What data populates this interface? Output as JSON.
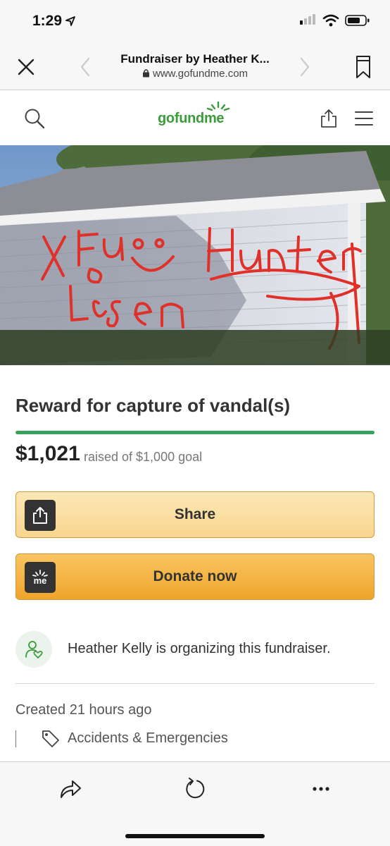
{
  "status_bar": {
    "time": "1:29",
    "icons": [
      "location-arrow-icon",
      "signal-icon",
      "wifi-icon",
      "battery-icon"
    ]
  },
  "browser": {
    "page_title": "Fundraiser by Heather K...",
    "url": "www.gofundme.com",
    "icons": [
      "close-icon",
      "back-icon",
      "forward-icon",
      "bookmarks-icon",
      "lock-icon"
    ]
  },
  "site_header": {
    "logo_text": "gofundme",
    "icons": [
      "search-icon",
      "share-icon",
      "menu-icon"
    ],
    "brand_color": "#3a9b3a"
  },
  "campaign": {
    "title": "Reward for capture of vandal(s)",
    "raised": "$1,021",
    "goal_text": "raised of $1,000 goal",
    "progress": 1.0,
    "progress_color": "#3aa35b"
  },
  "actions": {
    "share_label": "Share",
    "donate_label": "Donate now",
    "share_color": "#f8d68e",
    "donate_color": "#efa52b",
    "donate_icon_text": "me"
  },
  "organizer": {
    "text": "Heather Kelly is organizing this fundraiser."
  },
  "meta": {
    "created": "Created 21 hours ago",
    "category": "Accidents & Emergencies"
  },
  "toolbar": {
    "icons": [
      "share-icon",
      "reload-icon",
      "more-icon"
    ]
  }
}
